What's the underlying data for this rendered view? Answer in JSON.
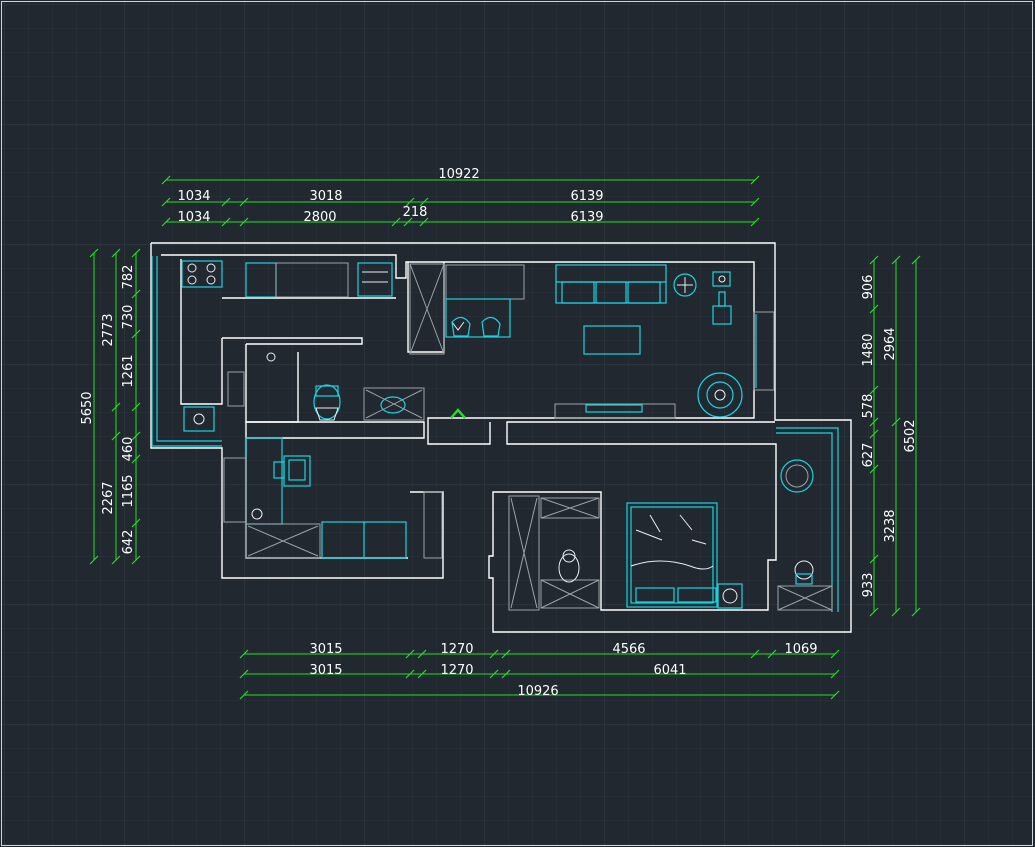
{
  "colors": {
    "background": "#212830",
    "grid_minor": "#2a323b",
    "grid_major": "#323b45",
    "dimension_line": "#22e022",
    "dimension_text": "#ffffff",
    "wall": "#ffffff",
    "furniture": "#19d4e0"
  },
  "dimensions": {
    "top_total": "10922",
    "top_row1": [
      "1034",
      "3018",
      "6139"
    ],
    "top_row2": [
      "1034",
      "2800",
      "218",
      "6139"
    ],
    "bottom_row1": [
      "3015",
      "1270",
      "4566",
      "1069"
    ],
    "bottom_row2": [
      "3015",
      "1270",
      "6041"
    ],
    "bottom_total": "10926",
    "left_outer": "5650",
    "left_mid": [
      "2773",
      "2267"
    ],
    "left_inner": [
      "782",
      "730",
      "1261",
      "460",
      "1165",
      "642"
    ],
    "right_inner": [
      "906",
      "1480",
      "578",
      "627",
      "3238",
      "933"
    ],
    "right_mid": [
      "2964"
    ],
    "right_outer": "6502"
  },
  "icons": {
    "north_marker": "chevron-up-icon"
  }
}
